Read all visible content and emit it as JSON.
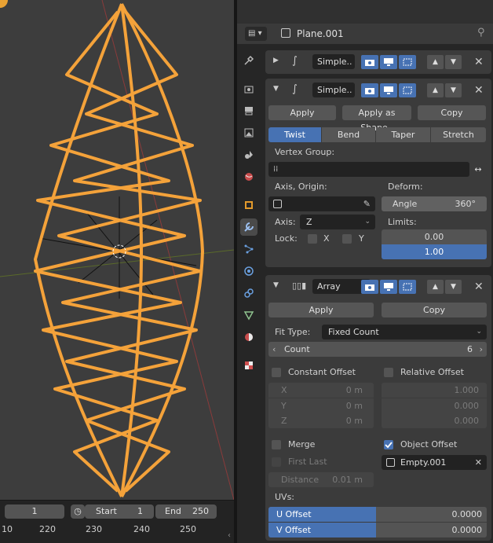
{
  "header": {
    "object_name": "Plane.001"
  },
  "modifier1": {
    "name": "Simple.."
  },
  "modifier2": {
    "name": "Simple..",
    "apply_label": "Apply",
    "apply_shape_label": "Apply as Shape..",
    "copy_label": "Copy",
    "modes": [
      "Twist",
      "Bend",
      "Taper",
      "Stretch"
    ],
    "active_mode": "Twist",
    "vertex_group_label": "Vertex Group:",
    "axis_origin_label": "Axis, Origin:",
    "deform_label": "Deform:",
    "angle_label": "Angle",
    "angle_value": "360°",
    "axis_label": "Axis:",
    "axis_value": "Z",
    "limits_label": "Limits:",
    "limit_low": "0.00",
    "limit_high": "1.00",
    "lock_label": "Lock:",
    "lock_x": "X",
    "lock_y": "Y"
  },
  "modifier3": {
    "name": "Array",
    "apply_label": "Apply",
    "copy_label": "Copy",
    "fit_type_label": "Fit Type:",
    "fit_type_value": "Fixed Count",
    "count_label": "Count",
    "count_value": "6",
    "constant_offset_label": "Constant Offset",
    "relative_offset_label": "Relative Offset",
    "const_x_label": "X",
    "const_x_value": "0 m",
    "const_y_label": "Y",
    "const_y_value": "0 m",
    "const_z_label": "Z",
    "const_z_value": "0 m",
    "rel_x_value": "1.000",
    "rel_y_value": "0.000",
    "rel_z_value": "0.000",
    "merge_label": "Merge",
    "first_last_label": "First Last",
    "distance_label": "Distance",
    "distance_value": "0.01 m",
    "object_offset_label": "Object Offset",
    "object_offset_value": "Empty.001",
    "uvs_label": "UVs:",
    "u_offset_label": "U Offset",
    "u_offset_value": "0.0000",
    "v_offset_label": "V Offset",
    "v_offset_value": "0.0000"
  },
  "timeline": {
    "current_frame": "1",
    "start_label": "Start",
    "start_value": "1",
    "end_label": "End",
    "end_value": "250",
    "ruler": [
      "10",
      "220",
      "230",
      "240",
      "250"
    ]
  },
  "colors": {
    "accent": "#4772b3",
    "selection": "#f4a23a"
  }
}
